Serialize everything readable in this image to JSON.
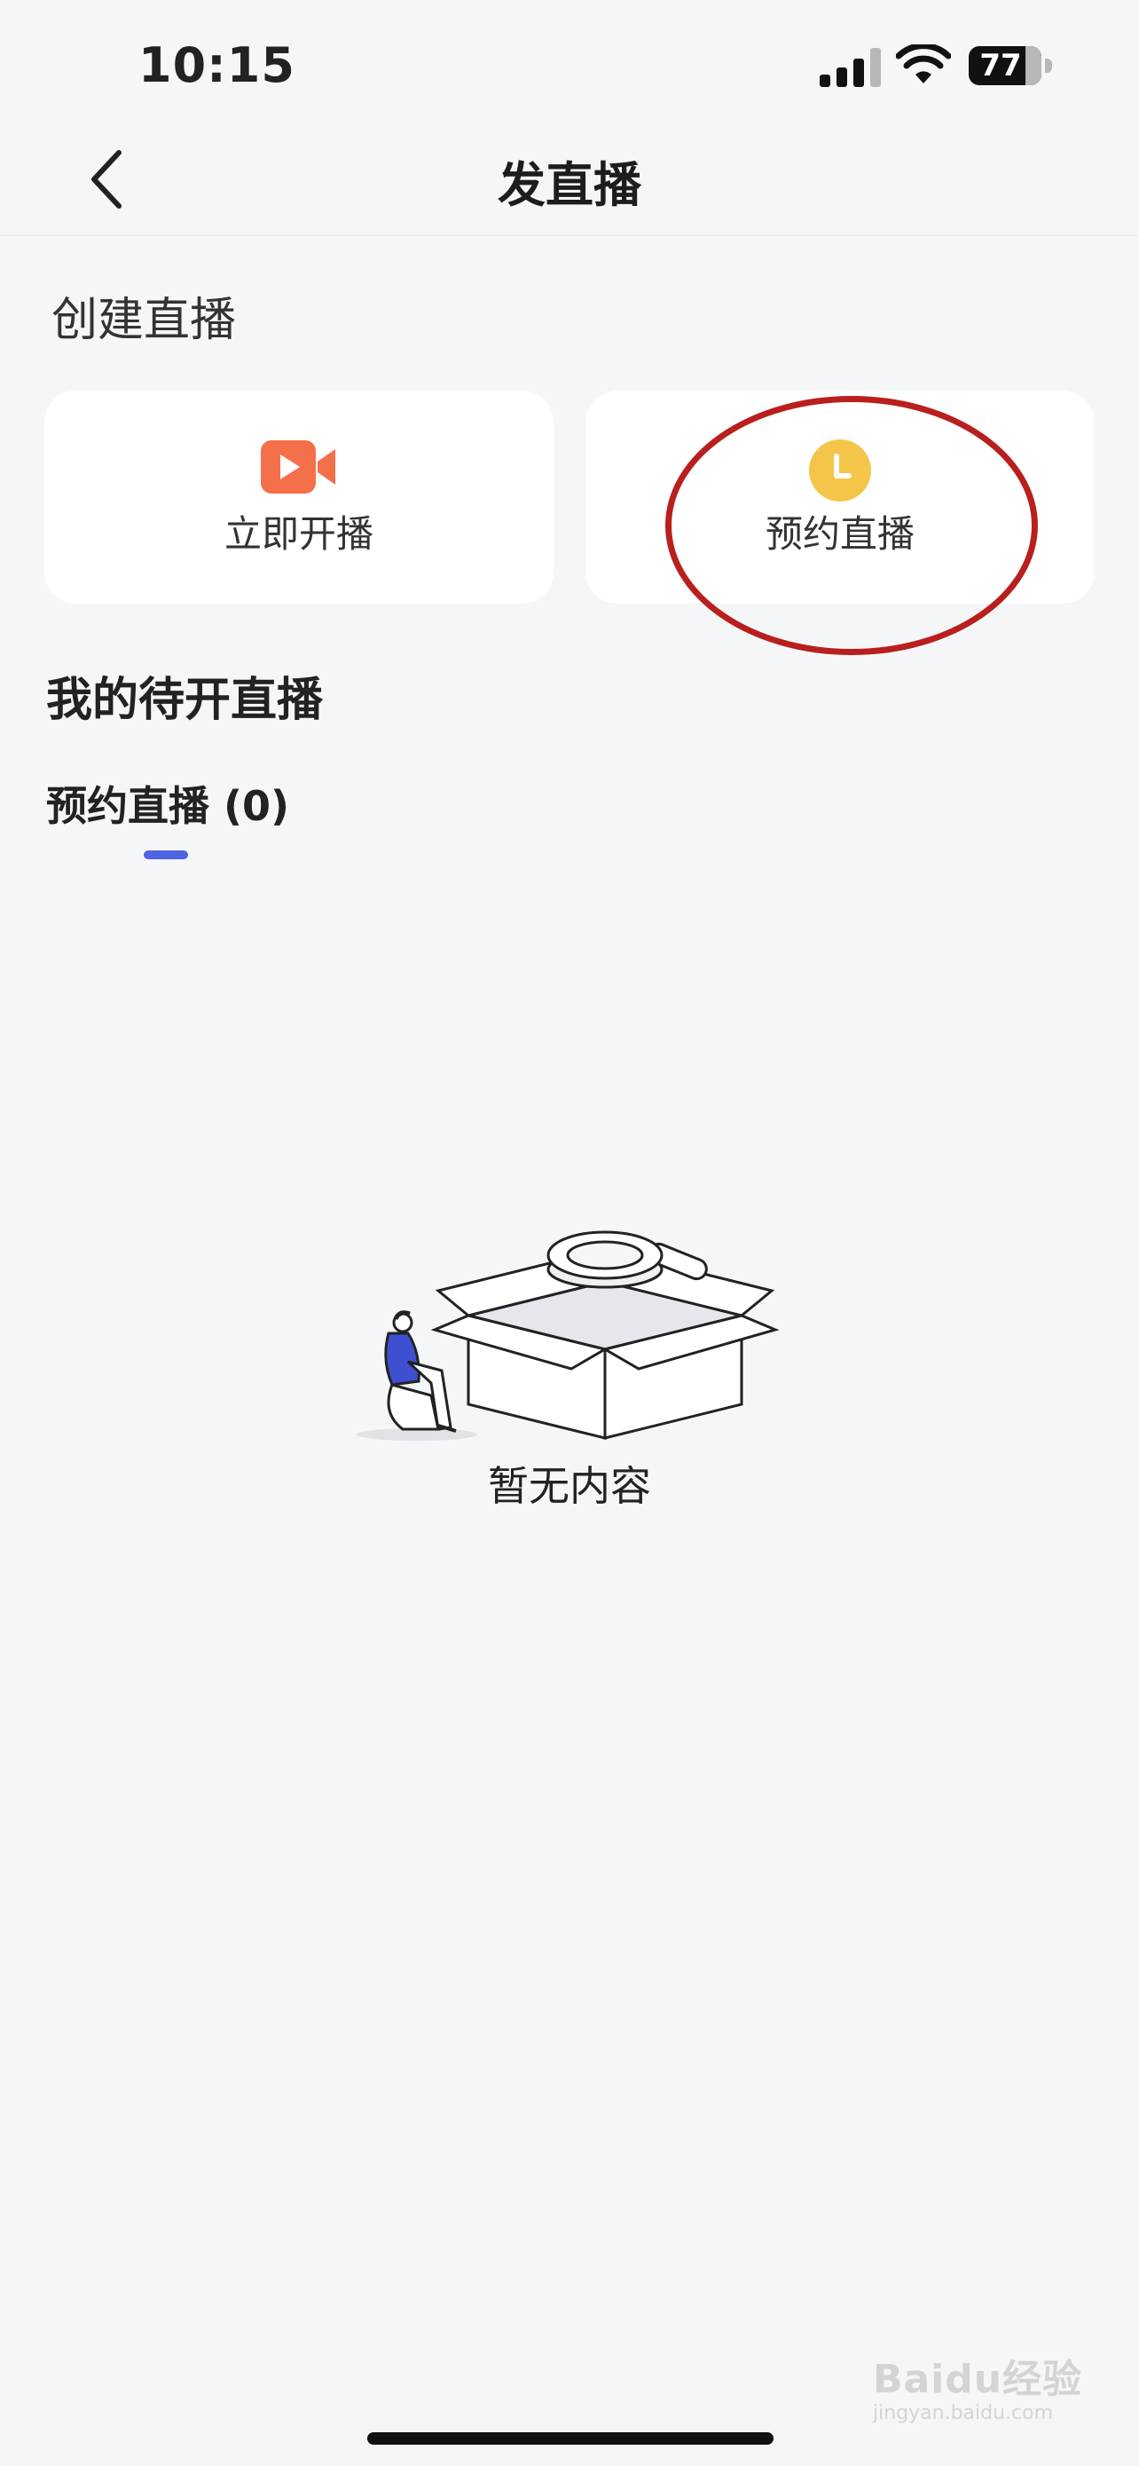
{
  "status_bar": {
    "time": "10:15",
    "battery": "77"
  },
  "nav": {
    "title": "发直播"
  },
  "create_section": {
    "title": "创建直播",
    "start_now": {
      "label": "立即开播",
      "icon": "video-camera-icon",
      "color": "#f3704a"
    },
    "schedule": {
      "label": "预约直播",
      "icon": "clock-icon",
      "color": "#f5c54a"
    }
  },
  "pending": {
    "title": "我的待开直播",
    "tab_label": "预约直播 (0)",
    "accent": "#4f64e3"
  },
  "empty_state": {
    "text": "暂无内容"
  },
  "watermark": {
    "text": "Baidu经验",
    "sub": "jingyan.baidu.com"
  }
}
